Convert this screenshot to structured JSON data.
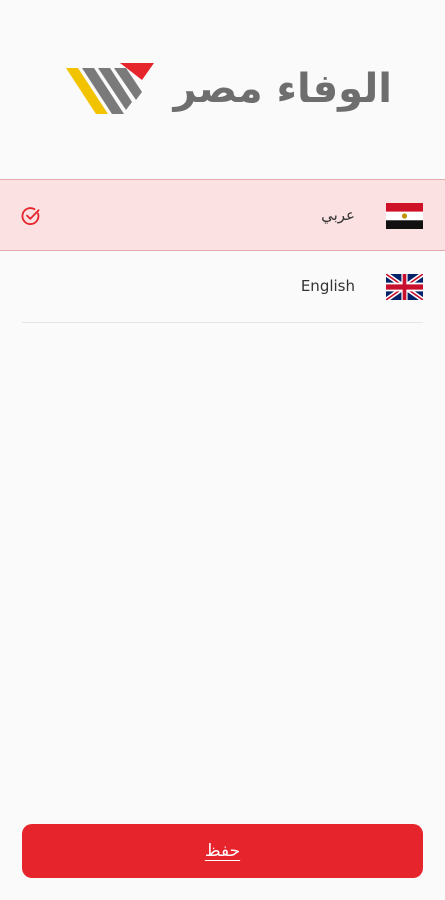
{
  "brand": {
    "name": "الوفاء مصر",
    "logo_icon": "wafaa-stripes-logo-icon",
    "colors": {
      "yellow": "#f2c300",
      "red": "#e5242b",
      "gray": "#6e6e6e"
    }
  },
  "languages": [
    {
      "label": "عربي",
      "flag_icon": "egypt-flag-icon",
      "selected": true
    },
    {
      "label": "English",
      "flag_icon": "uk-flag-icon",
      "selected": false
    }
  ],
  "selected_indicator_icon": "check-circle-icon",
  "accent_color": "#e5242b",
  "save_label": "حفظ"
}
